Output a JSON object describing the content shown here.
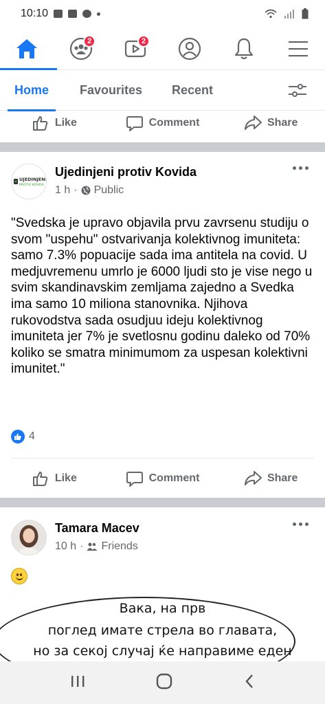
{
  "status_bar": {
    "time": "10:10"
  },
  "top_nav": {
    "items": [
      {
        "icon": "home-icon"
      },
      {
        "icon": "groups-icon",
        "badge": "2"
      },
      {
        "icon": "watch-icon",
        "badge": "2"
      },
      {
        "icon": "profile-icon"
      },
      {
        "icon": "bell-icon"
      },
      {
        "icon": "menu-icon"
      }
    ]
  },
  "tabs": {
    "home": "Home",
    "favourites": "Favourites",
    "recent": "Recent"
  },
  "actions": {
    "like": "Like",
    "comment": "Comment",
    "share": "Share"
  },
  "post1": {
    "avatar_text_top": "UJEDINJENI",
    "avatar_text_bottom": "PROTIV KOVIDA",
    "author": "Ujedinjeni protiv Kovida",
    "time": "1 h",
    "privacy": "Public",
    "text": "\"Svedska je upravo objavila prvu zavrsenu studiju o svom \"uspehu\" ostvarivanja kolektivnog imuniteta: samo 7.3% popuacije sada ima antitela na covid. U medjuvremenu umrlo je 6000 ljudi sto je vise nego u svim skandinavskim zemljama zajedno a Svedka ima samo 10 miliona stanovnika. Njihova rukovodstva sada osudjuu ideju kolektivnog imuniteta jer 7% je svetlosnu godinu daleko od 70% koliko se smatra minimumom za uspesan kolektivni imunitet.\"",
    "reaction_count": "4"
  },
  "post2": {
    "author": "Tamara Macev",
    "time": "10 h",
    "privacy": "Friends",
    "image_lines": [
      "Вака, на прв",
      "поглед имате стрела во главата,",
      "но за секој случај ќе направиме еден"
    ]
  },
  "colors": {
    "accent": "#1877f2",
    "secondary_text": "#65676b",
    "badge": "#f02849"
  }
}
